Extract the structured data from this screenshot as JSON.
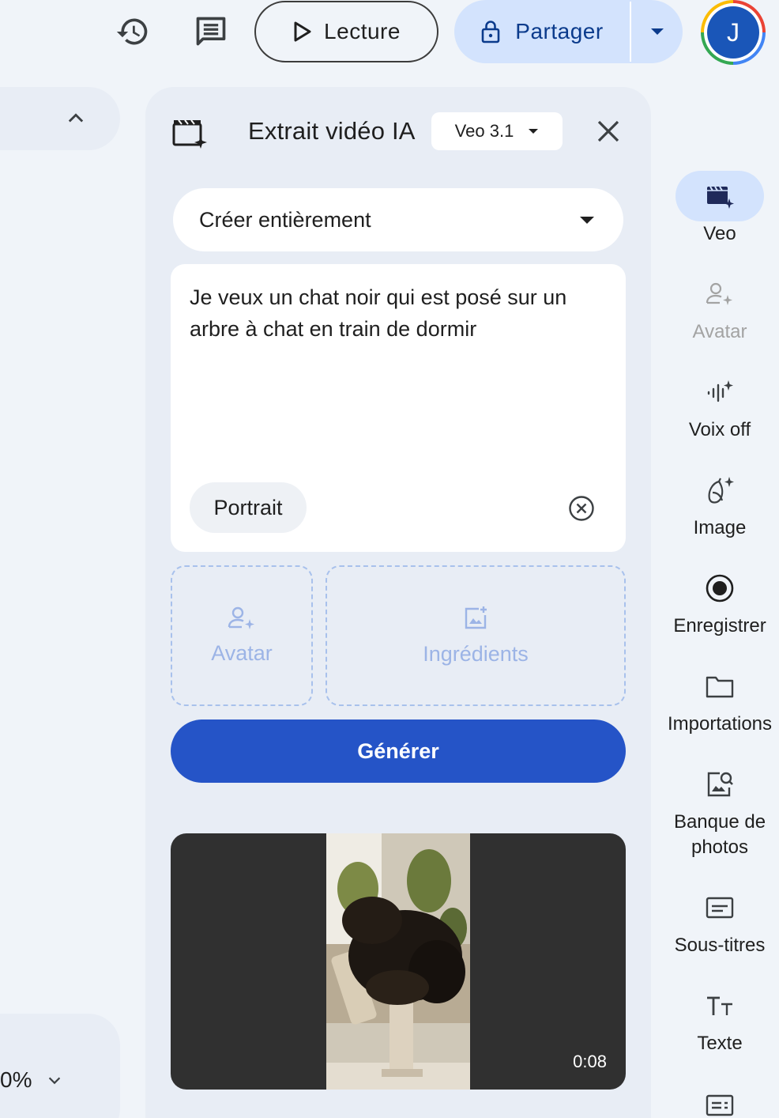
{
  "colors": {
    "background": "#f0f4f9",
    "panel": "#e8edf5",
    "primary": "#2554c7",
    "share_bg": "#d3e3fd",
    "share_text": "#0b3b8c",
    "avatar_bg": "#1a56b8",
    "dropzone": "#a8c1ec"
  },
  "topbar": {
    "play_label": "Lecture",
    "share_label": "Partager",
    "avatar_initial": "J",
    "icons": [
      "history-icon",
      "comment-icon",
      "play-icon",
      "lock-icon",
      "caret-down-icon"
    ]
  },
  "left": {
    "zoom_value": "0%"
  },
  "panel": {
    "title": "Extrait vidéo IA",
    "model": "Veo 3.1",
    "mode": "Créer entièrement",
    "prompt": "Je veux un chat noir qui est posé sur un arbre à chat en train de dormir",
    "orientation_chip": "Portrait",
    "dropzones": {
      "avatar": "Avatar",
      "ingredients": "Ingrédients"
    },
    "generate_label": "Générer",
    "video": {
      "duration": "0:08",
      "description_icon": "cat-video-thumbnail"
    }
  },
  "rail": {
    "items": [
      {
        "label": "Veo",
        "icon": "veo-icon",
        "active": true
      },
      {
        "label": "Avatar",
        "icon": "avatar-add-icon",
        "disabled": true
      },
      {
        "label": "Voix off",
        "icon": "voiceover-icon"
      },
      {
        "label": "Image",
        "icon": "image-banana-icon"
      },
      {
        "label": "Enregistrer",
        "icon": "record-icon"
      },
      {
        "label": "Importations",
        "icon": "folder-icon"
      },
      {
        "label": "Banque de photos",
        "icon": "stock-photos-icon"
      },
      {
        "label": "Sous-titres",
        "icon": "subtitles-icon"
      },
      {
        "label": "Texte",
        "icon": "text-icon"
      }
    ]
  }
}
